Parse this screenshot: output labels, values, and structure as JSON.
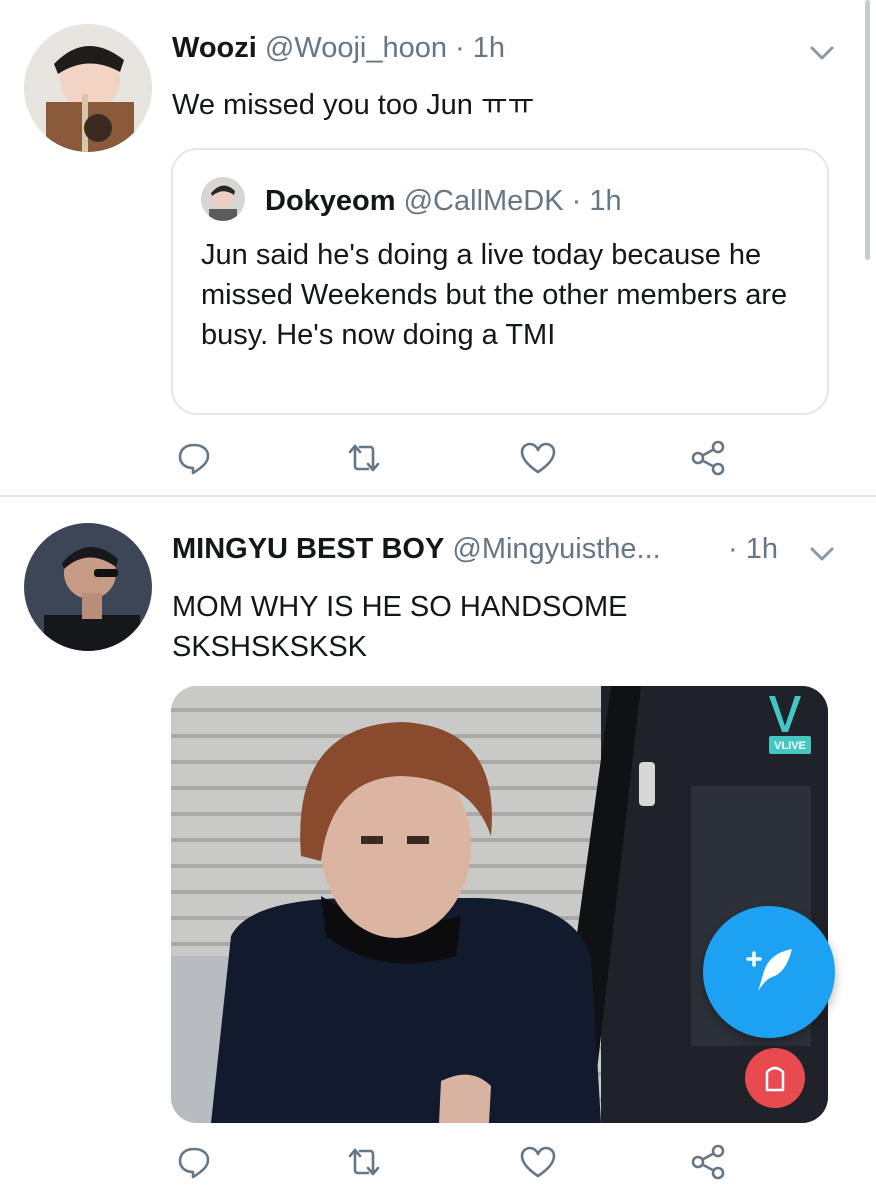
{
  "tweets": [
    {
      "name": "Woozi",
      "handle": "@Wooji_hoon",
      "separator": "·",
      "time": "1h",
      "text": "We missed you too Jun ㅠㅠ",
      "quoted": {
        "name": "Dokyeom",
        "handle": "@CallMeDK",
        "separator": "·",
        "time": "1h",
        "text": "Jun said he's doing a live today because he missed Weekends but the other members are busy. He's now doing a TMI"
      }
    },
    {
      "name": "MINGYU BEST BOY",
      "handle": "@Mingyuisthe...",
      "separator": "·",
      "time": "1h",
      "text_lines": [
        "MOM WHY IS HE SO HANDSOME",
        "SKSHSKSKSK"
      ],
      "media": {
        "watermark": "VLIVE"
      }
    }
  ],
  "icons": {
    "reply": "reply-icon",
    "retweet": "retweet-icon",
    "like": "heart-icon",
    "share": "share-icon",
    "menu": "chevron-down-icon",
    "compose": "compose-tweet-icon"
  },
  "colors": {
    "brand_blue": "#1da1f2",
    "text_primary": "#14171a",
    "text_secondary": "#657786",
    "border": "#e1e8ed",
    "action_icon": "#657786"
  }
}
